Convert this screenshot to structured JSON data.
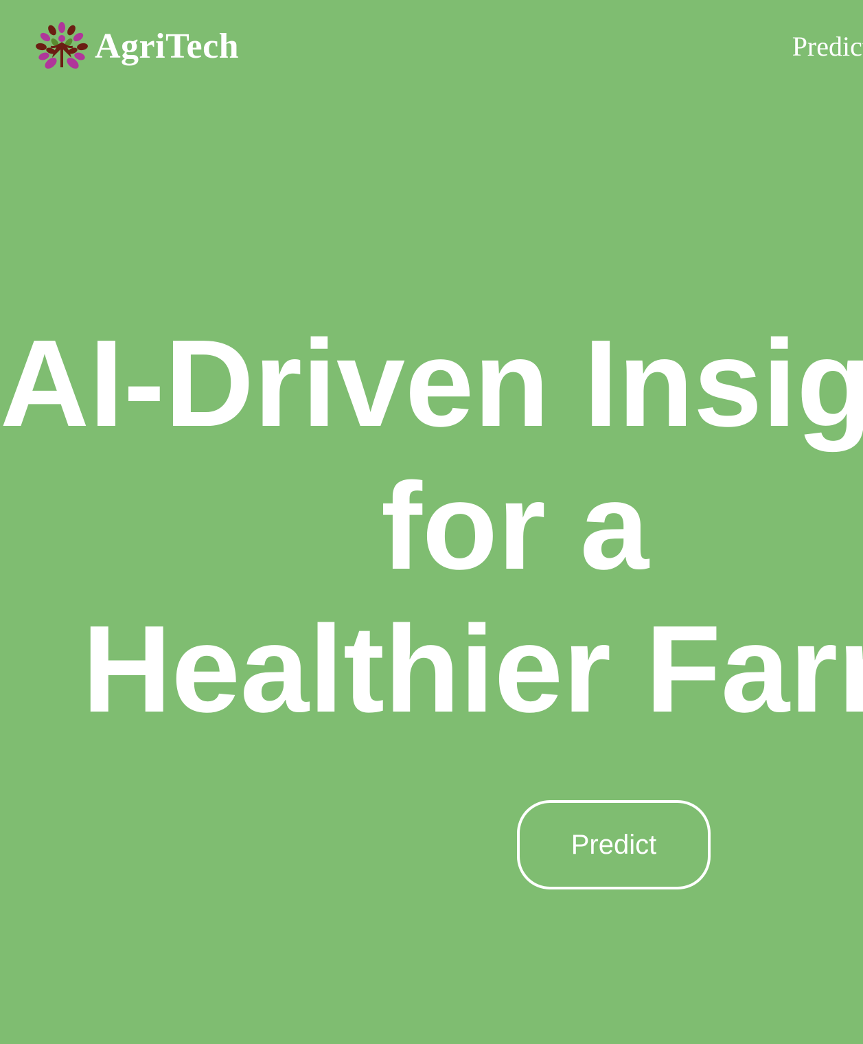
{
  "colors": {
    "background": "#7fbd71",
    "text": "#ffffff",
    "logo_leaf_purple": "#b0369a",
    "logo_leaf_green": "#5a8a2f",
    "logo_figure_brown": "#6b1e12"
  },
  "header": {
    "brand_name": "AgriTech",
    "logo_icon": "tree-figure-logo-icon",
    "nav": [
      {
        "label": "Predict"
      }
    ]
  },
  "hero": {
    "title_lines": [
      "AI-Driven Insights",
      "for a",
      "Healthier Farm"
    ],
    "cta_label": "Predict"
  }
}
